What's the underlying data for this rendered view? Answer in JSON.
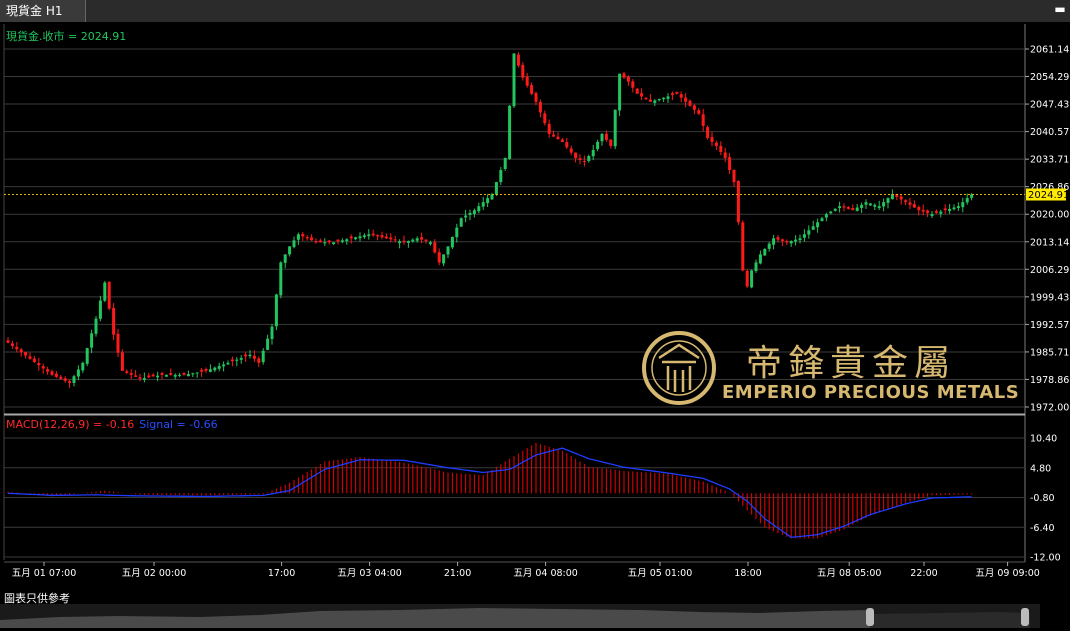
{
  "window": {
    "tab_title": "現貨金 H1",
    "close_glyph": "▬"
  },
  "price_legend": "現貨金.收市 = 2024.91",
  "macd_legend": {
    "macd": "MACD(12,26,9) = -0.16",
    "signal": "Signal = -0.66"
  },
  "footer": "圖表只供參考",
  "logo": {
    "title": "帝鋒貴金屬",
    "subtitle": "EMPERIO PRECIOUS METALS"
  },
  "colors": {
    "up": "#22c55e",
    "down": "#ff1a1a",
    "signal": "#1e3cff",
    "grid": "#3a3a3a",
    "current": "#ffea00",
    "logo": "#d6b870"
  },
  "chart_data": {
    "type": "candlestick",
    "current_price": 2024.91,
    "price_axis": {
      "ticks": [
        2061.14,
        2054.29,
        2047.43,
        2040.57,
        2033.71,
        2026.86,
        2020.0,
        2013.14,
        2006.29,
        1999.43,
        1992.57,
        1985.71,
        1978.86,
        1972.0
      ]
    },
    "macd_axis": {
      "ticks": [
        10.4,
        4.8,
        -0.8,
        -6.4,
        -12.0
      ]
    },
    "x_labels": [
      "五月 01 07:00",
      "五月 02 00:00",
      "17:00",
      "五月 03 04:00",
      "21:00",
      "五月 04 08:00",
      "五月 05 01:00",
      "18:00",
      "五月 08 05:00",
      "22:00",
      "五月 09 09:00"
    ],
    "close_anchors": [
      [
        0,
        1988
      ],
      [
        5,
        1984
      ],
      [
        10,
        1980
      ],
      [
        14,
        1978
      ],
      [
        17,
        1983
      ],
      [
        20,
        1994
      ],
      [
        22,
        2003
      ],
      [
        24,
        1990
      ],
      [
        26,
        1981
      ],
      [
        30,
        1979
      ],
      [
        35,
        1980
      ],
      [
        40,
        1980
      ],
      [
        45,
        1981
      ],
      [
        50,
        1983
      ],
      [
        55,
        1985
      ],
      [
        57,
        1983
      ],
      [
        60,
        1992
      ],
      [
        62,
        2008
      ],
      [
        64,
        2012
      ],
      [
        66,
        2015
      ],
      [
        70,
        2013
      ],
      [
        74,
        2013
      ],
      [
        78,
        2014
      ],
      [
        82,
        2015
      ],
      [
        86,
        2014
      ],
      [
        90,
        2013
      ],
      [
        93,
        2014
      ],
      [
        96,
        2013
      ],
      [
        98,
        2008
      ],
      [
        100,
        2012
      ],
      [
        103,
        2019
      ],
      [
        106,
        2021
      ],
      [
        110,
        2025
      ],
      [
        113,
        2034
      ],
      [
        115,
        2060
      ],
      [
        117,
        2054
      ],
      [
        120,
        2048
      ],
      [
        123,
        2040
      ],
      [
        126,
        2038
      ],
      [
        129,
        2034
      ],
      [
        131,
        2033
      ],
      [
        133,
        2036
      ],
      [
        135,
        2040
      ],
      [
        137,
        2037
      ],
      [
        139,
        2055
      ],
      [
        141,
        2053
      ],
      [
        143,
        2050
      ],
      [
        146,
        2048
      ],
      [
        149,
        2049
      ],
      [
        152,
        2050
      ],
      [
        155,
        2047
      ],
      [
        157,
        2045
      ],
      [
        159,
        2039
      ],
      [
        161,
        2037
      ],
      [
        163,
        2034
      ],
      [
        165,
        2028
      ],
      [
        166,
        2018
      ],
      [
        167,
        2006
      ],
      [
        168,
        2002
      ],
      [
        169,
        2006
      ],
      [
        171,
        2010
      ],
      [
        174,
        2014
      ],
      [
        177,
        2013
      ],
      [
        180,
        2014
      ],
      [
        183,
        2017
      ],
      [
        186,
        2020
      ],
      [
        189,
        2022
      ],
      [
        192,
        2021
      ],
      [
        195,
        2023
      ],
      [
        198,
        2022
      ],
      [
        201,
        2025
      ],
      [
        204,
        2023
      ],
      [
        207,
        2021
      ],
      [
        210,
        2020
      ],
      [
        213,
        2021
      ],
      [
        216,
        2022
      ],
      [
        218,
        2024
      ],
      [
        219,
        2024.91
      ]
    ],
    "macd_anchors": [
      [
        0,
        0.3
      ],
      [
        10,
        -0.6
      ],
      [
        22,
        0.5
      ],
      [
        30,
        -0.3
      ],
      [
        45,
        -0.4
      ],
      [
        58,
        -0.2
      ],
      [
        64,
        2
      ],
      [
        72,
        6
      ],
      [
        80,
        6.8
      ],
      [
        90,
        5.8
      ],
      [
        100,
        3.9
      ],
      [
        108,
        3.4
      ],
      [
        114,
        6.5
      ],
      [
        120,
        9.5
      ],
      [
        126,
        8
      ],
      [
        132,
        5
      ],
      [
        140,
        4.2
      ],
      [
        150,
        3.7
      ],
      [
        158,
        2.2
      ],
      [
        164,
        0.1
      ],
      [
        168,
        -3.2
      ],
      [
        172,
        -6.5
      ],
      [
        178,
        -8.5
      ],
      [
        184,
        -8.5
      ],
      [
        190,
        -6.8
      ],
      [
        196,
        -4.2
      ],
      [
        204,
        -1.8
      ],
      [
        210,
        -0.4
      ],
      [
        219,
        -0.2
      ]
    ],
    "signal_anchors": [
      [
        0,
        0
      ],
      [
        10,
        -0.4
      ],
      [
        20,
        -0.3
      ],
      [
        30,
        -0.5
      ],
      [
        45,
        -0.6
      ],
      [
        58,
        -0.4
      ],
      [
        64,
        0.5
      ],
      [
        72,
        4.5
      ],
      [
        80,
        6.3
      ],
      [
        90,
        6.2
      ],
      [
        100,
        4.8
      ],
      [
        108,
        3.9
      ],
      [
        114,
        4.5
      ],
      [
        120,
        7.2
      ],
      [
        126,
        8.5
      ],
      [
        132,
        6.5
      ],
      [
        140,
        4.9
      ],
      [
        150,
        3.8
      ],
      [
        158,
        2.8
      ],
      [
        164,
        0.8
      ],
      [
        168,
        -1.5
      ],
      [
        172,
        -4.8
      ],
      [
        178,
        -8.3
      ],
      [
        184,
        -7.8
      ],
      [
        190,
        -6.2
      ],
      [
        196,
        -4
      ],
      [
        204,
        -2
      ],
      [
        210,
        -0.9
      ],
      [
        219,
        -0.66
      ]
    ]
  }
}
